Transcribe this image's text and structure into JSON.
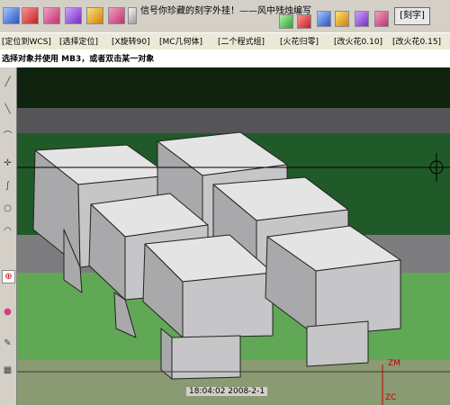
{
  "app": {
    "marquee": "信号你珍藏的刻字外挂！——风中残烛编写",
    "mc_tab_label": "[刻字]"
  },
  "toolbar_icons": [
    "box-icon",
    "grid-icon",
    "cube-icon",
    "cube-icon",
    "solid-icon",
    "rotate-icon",
    "settings-icon",
    "shape-icon",
    "paint-icon",
    "layers-icon",
    "chart-icon",
    "folder-icon"
  ],
  "menu": [
    "[定位到WCS]",
    "[选择定位]",
    "[X旋转90]",
    "[MC几何体]",
    "[二个程式组]",
    "[火花归零]",
    "[改火花0.10]",
    "[改火花0.15]"
  ],
  "prompt": "选择对象并使用 MB3，或者双击某一对象",
  "status": {
    "timestamp": "18:04:02  2008-2-1",
    "axis_zm": "ZM",
    "axis_zc": "ZC"
  },
  "colors": {
    "top_bg": "#10230f",
    "gray_band": "#555558",
    "green_band": "#1f5a28",
    "light_green": "#60a855",
    "box_top": "#e4e4e4",
    "box_left": "#a9a9ab",
    "box_right": "#c6c6c8",
    "axis_red": "#c00000"
  }
}
